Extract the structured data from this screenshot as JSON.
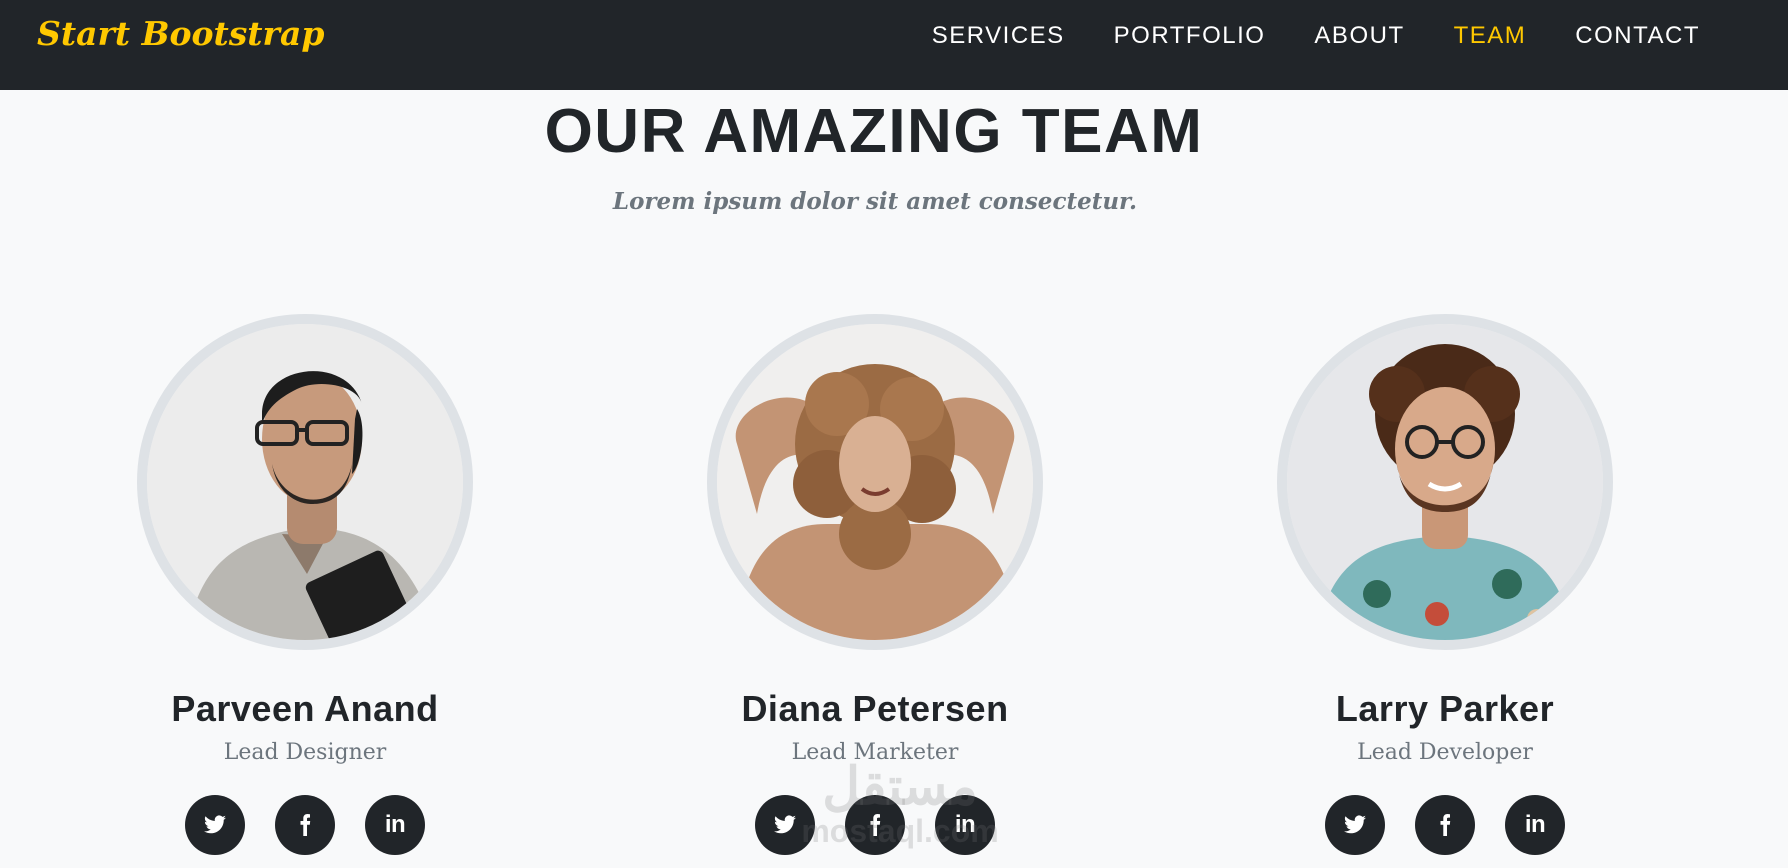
{
  "navbar": {
    "brand": "Start Bootstrap",
    "links": [
      {
        "label": "SERVICES",
        "active": false
      },
      {
        "label": "PORTFOLIO",
        "active": false
      },
      {
        "label": "ABOUT",
        "active": false
      },
      {
        "label": "TEAM",
        "active": true
      },
      {
        "label": "CONTACT",
        "active": false
      }
    ],
    "active_color": "#ffc800"
  },
  "team": {
    "heading": "OUR AMAZING TEAM",
    "subheading": "Lorem ipsum dolor sit amet consectetur.",
    "members": [
      {
        "name": "Parveen Anand",
        "role": "Lead Designer",
        "socials": [
          "twitter-icon",
          "facebook-icon",
          "linkedin-icon"
        ]
      },
      {
        "name": "Diana Petersen",
        "role": "Lead Marketer",
        "socials": [
          "twitter-icon",
          "facebook-icon",
          "linkedin-icon"
        ]
      },
      {
        "name": "Larry Parker",
        "role": "Lead Developer",
        "socials": [
          "twitter-icon",
          "facebook-icon",
          "linkedin-icon"
        ]
      }
    ]
  },
  "watermark": {
    "top": "مستقل",
    "bottom": "mostaql.com"
  }
}
